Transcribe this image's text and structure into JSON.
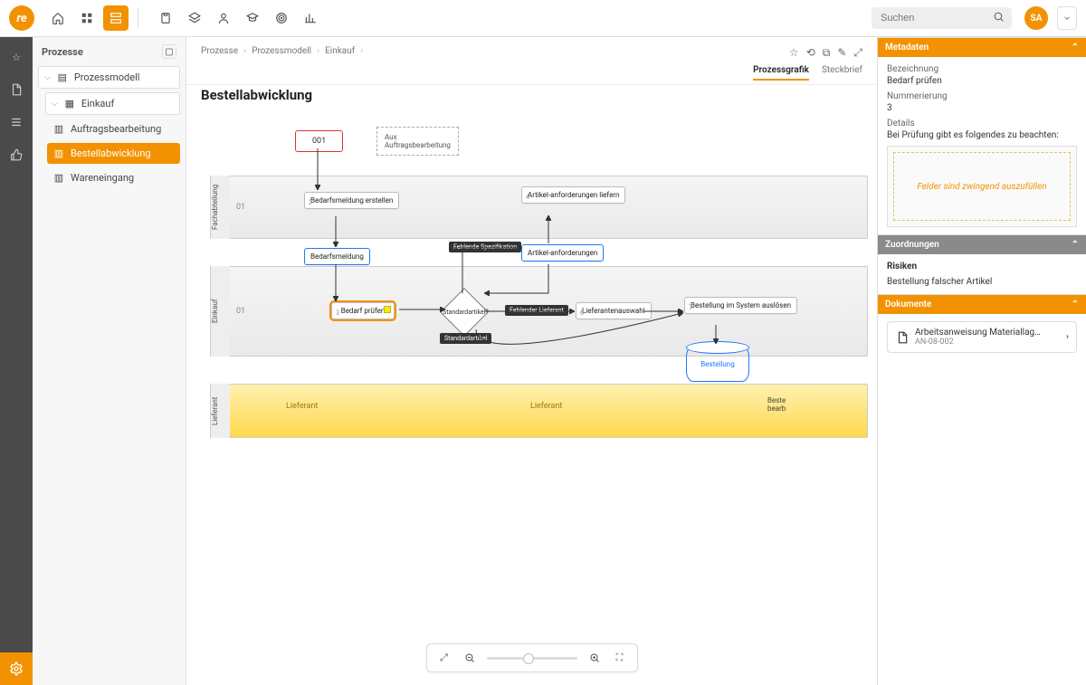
{
  "colors": {
    "accent": "#f39200",
    "blue": "#1f77ff"
  },
  "topbar": {
    "search_placeholder": "Suchen",
    "avatar_initials": "SA"
  },
  "sidebar": {
    "title": "Prozesse",
    "items": [
      {
        "label": "Prozessmodell",
        "icon": "document"
      },
      {
        "label": "Einkauf",
        "icon": "grid"
      }
    ],
    "children": [
      {
        "label": "Auftragsbearbeitung"
      },
      {
        "label": "Bestellabwicklung",
        "active": true
      },
      {
        "label": "Wareneingang"
      }
    ]
  },
  "breadcrumbs": [
    "Prozesse",
    "Prozessmodell",
    "Einkauf"
  ],
  "page_title": "Bestellabwicklung",
  "view_tabs": {
    "active": "Prozessgrafik",
    "other": "Steckbrief"
  },
  "diagram": {
    "start": "001",
    "aux": "Aux\nAuftragsbearbeitung",
    "lanes": [
      {
        "id": "01",
        "name": "Fachabteilung"
      },
      {
        "id": "01",
        "name": "Einkauf"
      },
      {
        "id": "",
        "name": "Lieferant"
      }
    ],
    "nodes": {
      "n1": {
        "label": "Bedarfsmeldung erstellen",
        "num": "2"
      },
      "n2": {
        "label": "Artikel-anforderungen liefern",
        "num": "4"
      },
      "d1": {
        "label": "Bedarfsmeldung"
      },
      "d2": {
        "label": "Artikel-anforderungen"
      },
      "n3": {
        "label": "Bedarf prüfen",
        "num": "3"
      },
      "g1": {
        "label": "Standardartikel?"
      },
      "n4": {
        "label": "Lieferantenauswahl",
        "num": "6"
      },
      "n5": {
        "label": "Bestellung im System auslösen",
        "num": "7"
      },
      "db": {
        "label": "Bestellung"
      },
      "l1": {
        "label": "Lieferant"
      },
      "l2": {
        "label": "Lieferant"
      },
      "l3": {
        "label": "Beste\nbearb"
      }
    },
    "chips": {
      "c1": "Fehlende Spezifikation",
      "c2": "Fehlender Lieferant",
      "c3": "Standardartikel"
    }
  },
  "panels": {
    "metadata": {
      "title": "Metadaten",
      "rows": {
        "bezeichnung_k": "Bezeichnung",
        "bezeichnung_v": "Bedarf prüfen",
        "nummer_k": "Nummerierung",
        "nummer_v": "3",
        "details_k": "Details",
        "details_v": "Bei Prüfung gibt es folgendes zu beachten:"
      },
      "img_note": "Felder sind zwingend auszufüllen"
    },
    "zuord": {
      "title": "Zuordnungen",
      "sub_title": "Risiken",
      "item": "Bestellung falscher Artikel"
    },
    "docs": {
      "title": "Dokumente",
      "item_title": "Arbeitsanweisung Materiallag…",
      "item_sub": "AN-08-002"
    }
  }
}
